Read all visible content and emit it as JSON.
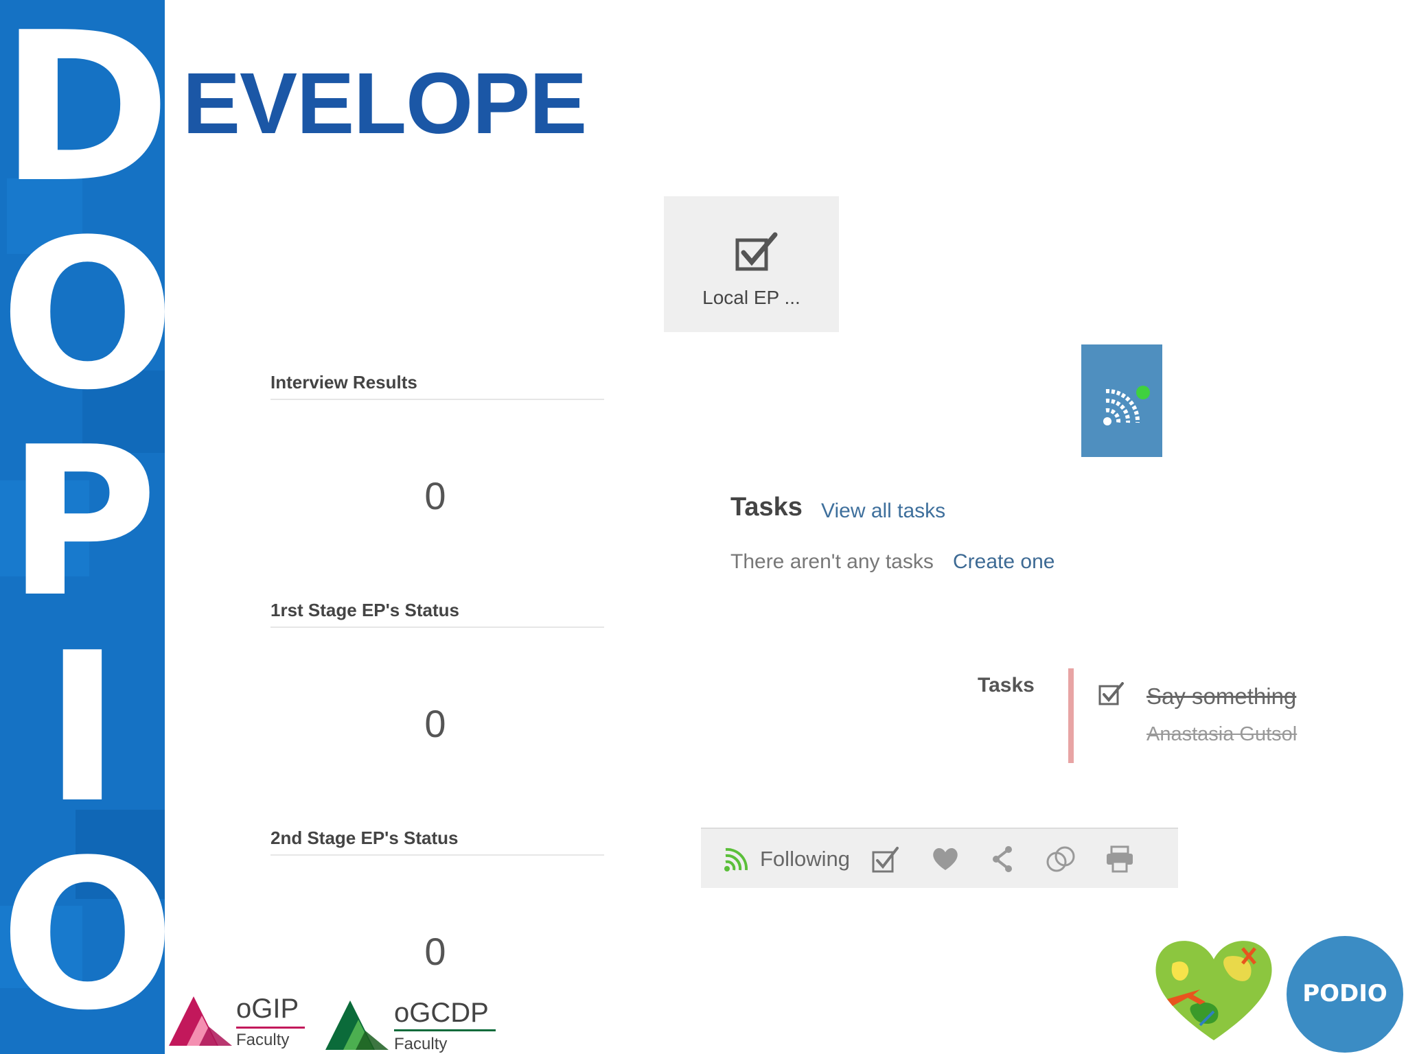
{
  "banner": {
    "letters": [
      "D",
      "O",
      "P",
      "I",
      "O"
    ],
    "color": "#1572c4"
  },
  "title": "EVELOPE",
  "widgets": [
    {
      "label": "Interview Results",
      "value": "0"
    },
    {
      "label": "1rst Stage EP's Status",
      "value": "0"
    },
    {
      "label": "2nd Stage EP's Status",
      "value": "0"
    }
  ],
  "app_card": {
    "label": "Local EP ...",
    "icon": "checkbox-icon"
  },
  "feed_tile": {
    "icon": "rss-feed-icon",
    "color": "#4f8fbf"
  },
  "tasks": {
    "heading": "Tasks",
    "view_all": "View all tasks",
    "empty": "There aren't any tasks",
    "create": "Create one"
  },
  "task_entry": {
    "label": "Tasks",
    "title": "Say something",
    "user": "Anastasia Gutsol"
  },
  "toolbar": {
    "following": "Following",
    "icons": [
      "rss-icon",
      "checkbox-icon",
      "heart-icon",
      "share-icon",
      "link-icon",
      "print-icon"
    ]
  },
  "logos": {
    "ogip": {
      "name": "oGIP",
      "sub": "Faculty"
    },
    "ogcdp": {
      "name": "oGCDP",
      "sub": "Faculty"
    },
    "podio": "PODIO"
  }
}
